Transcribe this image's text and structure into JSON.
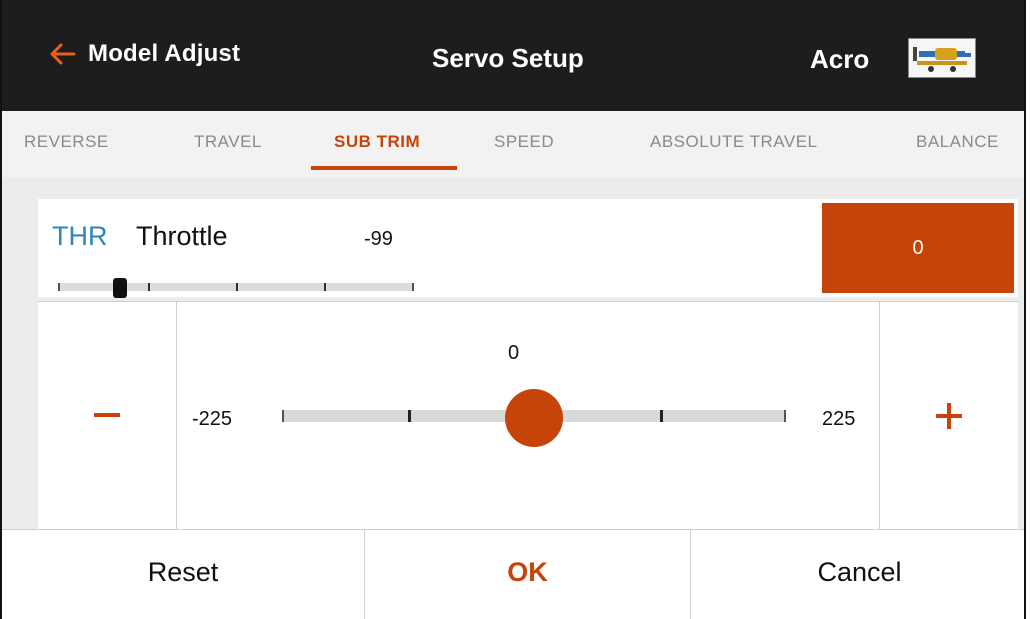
{
  "header": {
    "back_label": "Model Adjust",
    "title": "Servo Setup",
    "model_name": "Acro"
  },
  "tabs": [
    {
      "label": "REVERSE",
      "active": false
    },
    {
      "label": "TRAVEL",
      "active": false
    },
    {
      "label": "SUB TRIM",
      "active": true
    },
    {
      "label": "SPEED",
      "active": false
    },
    {
      "label": "ABSOLUTE TRAVEL",
      "active": false
    },
    {
      "label": "BALANCE",
      "active": false
    }
  ],
  "channel": {
    "abbr": "THR",
    "name": "Throttle",
    "value": "-99",
    "value_number": -99,
    "subtrim_value": "0"
  },
  "editor": {
    "current": "0",
    "current_number": 0,
    "min": "-225",
    "max": "225",
    "min_number": -225,
    "max_number": 225,
    "minus_icon": "minus-icon",
    "plus_icon": "plus-icon"
  },
  "footer": {
    "reset_label": "Reset",
    "ok_label": "OK",
    "cancel_label": "Cancel"
  },
  "colors": {
    "accent": "#c64309",
    "header_bg": "#1d1d1d",
    "channel_abbr": "#2e86c1"
  }
}
